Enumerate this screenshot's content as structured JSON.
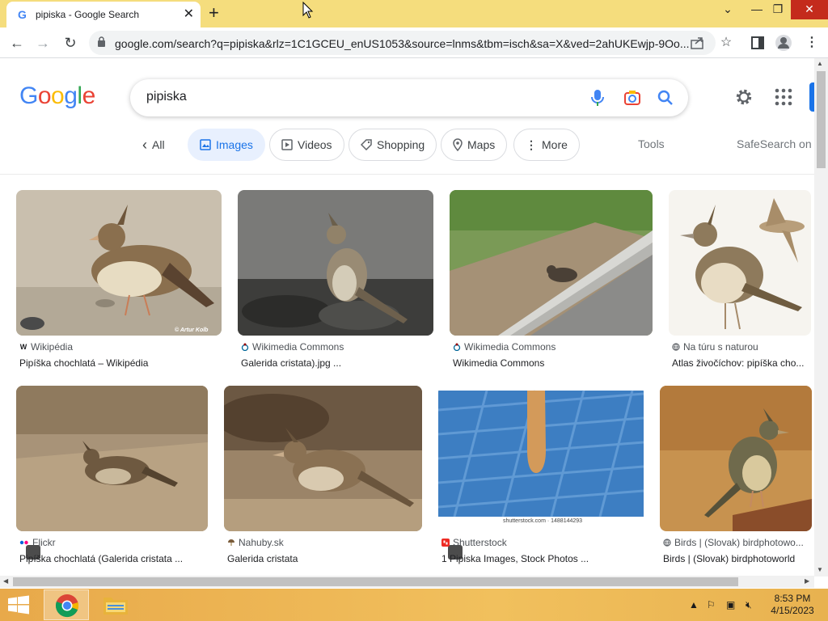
{
  "browser": {
    "tab_title": "pipiska - Google Search",
    "tab_favicon": "G",
    "new_tab_label": "+",
    "url": "google.com/search?q=pipiska&rlz=1C1GCEU_enUS1053&source=lnms&tbm=isch&sa=X&ved=2ahUKEwjp-9Oo..."
  },
  "google": {
    "logo": [
      "G",
      "o",
      "o",
      "g",
      "l",
      "e"
    ],
    "logo_colors": [
      "#4285f4",
      "#ea4335",
      "#fbbc05",
      "#4285f4",
      "#34a853",
      "#ea4335"
    ],
    "query": "pipiska"
  },
  "filters": {
    "all": "All",
    "images": "Images",
    "videos": "Videos",
    "shopping": "Shopping",
    "maps": "Maps",
    "more": "More",
    "tools": "Tools",
    "safesearch": "SafeSearch on"
  },
  "results": [
    {
      "source": "Wikipédia",
      "title": "Pipíška chochlatá – Wikipédia",
      "favicon": "W"
    },
    {
      "source": "Wikimedia Commons",
      "title": "Galerida cristata).jpg ...",
      "favicon": "wikimedia-icon"
    },
    {
      "source": "Wikimedia Commons",
      "title": "Wikimedia Commons",
      "favicon": "wikimedia-icon"
    },
    {
      "source": "Na túru s naturou",
      "title": "Atlas živočíchov: pipíška cho...",
      "favicon": "globe-icon"
    },
    {
      "source": "Flickr",
      "title": "Pipíška chochlatá (Galerida cristata ...",
      "favicon": "flickr-icon"
    },
    {
      "source": "Nahuby.sk",
      "title": "Galerida cristata",
      "favicon": "mushroom-icon"
    },
    {
      "source": "Shutterstock",
      "title": "1 Pipiska Images, Stock Photos ...",
      "favicon": "shutterstock-icon"
    },
    {
      "source": "Birds | (Slovak) birdphotowo...",
      "title": "Birds | (Slovak) birdphotoworld",
      "favicon": "globe-icon"
    }
  ],
  "image_text": {
    "watermark_1": "© Artur Kolb",
    "shutterstock_caption": "shutterstock.com · 1488144293"
  },
  "taskbar": {
    "time": "8:53 PM",
    "date": "4/15/2023"
  },
  "colors": {
    "tab_strip": "#f5dd7d",
    "accent": "#1a73e8",
    "active_chip_bg": "#e8f0fe",
    "close_button": "#c42b1c"
  }
}
